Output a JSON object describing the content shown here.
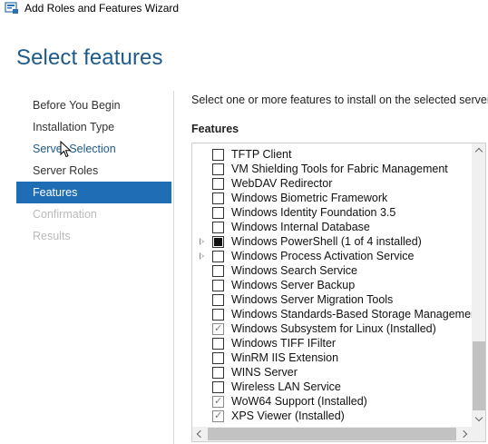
{
  "window": {
    "title": "Add Roles and Features Wizard",
    "icon": "server-manager-icon"
  },
  "page": {
    "title": "Select features"
  },
  "nav": {
    "items": [
      {
        "label": "Before You Begin",
        "state": "normal"
      },
      {
        "label": "Installation Type",
        "state": "normal"
      },
      {
        "label": "Server Selection",
        "state": "link"
      },
      {
        "label": "Server Roles",
        "state": "normal"
      },
      {
        "label": "Features",
        "state": "active"
      },
      {
        "label": "Confirmation",
        "state": "disabled"
      },
      {
        "label": "Results",
        "state": "disabled"
      }
    ]
  },
  "content": {
    "instruction": "Select one or more features to install on the selected server.",
    "features_label": "Features"
  },
  "features": [
    {
      "label": "TFTP Client",
      "state": "unchecked",
      "expandable": false
    },
    {
      "label": "VM Shielding Tools for Fabric Management",
      "state": "unchecked",
      "expandable": false
    },
    {
      "label": "WebDAV Redirector",
      "state": "unchecked",
      "expandable": false
    },
    {
      "label": "Windows Biometric Framework",
      "state": "unchecked",
      "expandable": false
    },
    {
      "label": "Windows Identity Foundation 3.5",
      "state": "unchecked",
      "expandable": false
    },
    {
      "label": "Windows Internal Database",
      "state": "unchecked",
      "expandable": false
    },
    {
      "label": "Windows PowerShell (1 of 4 installed)",
      "state": "partial",
      "expandable": true
    },
    {
      "label": "Windows Process Activation Service",
      "state": "unchecked",
      "expandable": true
    },
    {
      "label": "Windows Search Service",
      "state": "unchecked",
      "expandable": false
    },
    {
      "label": "Windows Server Backup",
      "state": "unchecked",
      "expandable": false
    },
    {
      "label": "Windows Server Migration Tools",
      "state": "unchecked",
      "expandable": false
    },
    {
      "label": "Windows Standards-Based Storage Management",
      "state": "unchecked",
      "expandable": false
    },
    {
      "label": "Windows Subsystem for Linux (Installed)",
      "state": "checked-disabled",
      "expandable": false
    },
    {
      "label": "Windows TIFF IFilter",
      "state": "unchecked",
      "expandable": false
    },
    {
      "label": "WinRM IIS Extension",
      "state": "unchecked",
      "expandable": false
    },
    {
      "label": "WINS Server",
      "state": "unchecked",
      "expandable": false
    },
    {
      "label": "Wireless LAN Service",
      "state": "unchecked",
      "expandable": false
    },
    {
      "label": "WoW64 Support (Installed)",
      "state": "checked-disabled",
      "expandable": false
    },
    {
      "label": "XPS Viewer (Installed)",
      "state": "checked-disabled",
      "expandable": false
    }
  ],
  "colors": {
    "accent": "#1f6db5",
    "title": "#1e5a8a",
    "disabled_text": "#bbbbbb"
  }
}
